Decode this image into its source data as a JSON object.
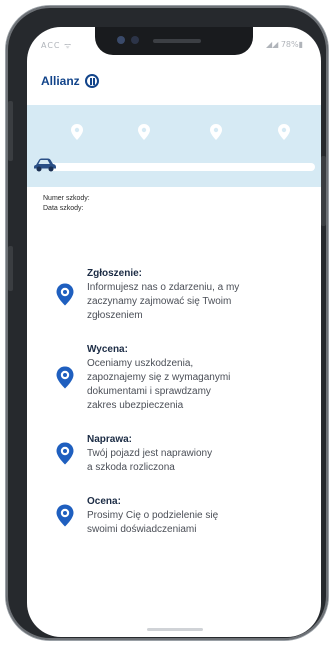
{
  "statusbar": {
    "left": "ACC  ᯤ",
    "right": "◢◢ 78%▮"
  },
  "header": {
    "logo_text": "Allianz"
  },
  "progress": {
    "stage_index": 0,
    "stage_count": 4
  },
  "claim": {
    "number_label": "Numer szkody:",
    "date_label": "Data szkody:"
  },
  "steps": [
    {
      "title": "Zgłoszenie:",
      "lines": [
        "Informujesz nas o zdarzeniu, a my",
        "zaczynamy zajmować się Twoim",
        "zgłoszeniem"
      ]
    },
    {
      "title": "Wycena:",
      "lines": [
        "Oceniamy uszkodzenia,",
        "zapoznajemy się z wymaganymi",
        "dokumentami i sprawdzamy",
        "zakres ubezpieczenia"
      ]
    },
    {
      "title": "Naprawa:",
      "lines": [
        "Twój pojazd jest naprawiony",
        "a szkoda rozliczona"
      ]
    },
    {
      "title": "Ocena:",
      "lines": [
        "Prosimy Cię o podzielenie się",
        "swoimi doświadczeniami"
      ]
    }
  ],
  "colors": {
    "brand": "#12448a",
    "banner": "#d6eaf4",
    "icon_blue": "#1f5fbf"
  }
}
